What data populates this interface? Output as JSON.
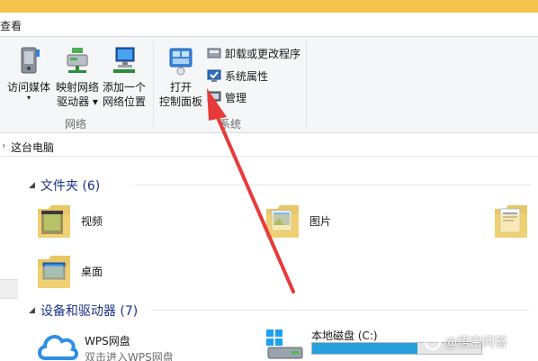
{
  "tabs": {
    "view": "查看"
  },
  "ribbon": {
    "network_group": {
      "label": "网络",
      "buttons": [
        {
          "id": "media",
          "label": "访问媒体"
        },
        {
          "id": "map_drive",
          "label_line1": "映射网络",
          "label_line2": "驱动器"
        },
        {
          "id": "add_location",
          "label_line1": "添加一个",
          "label_line2": "网络位置"
        }
      ]
    },
    "system_group": {
      "label": "系统",
      "open_control_panel": {
        "label_line1": "打开",
        "label_line2": "控制面板"
      },
      "small_buttons": [
        {
          "id": "uninstall",
          "label": "卸载或更改程序"
        },
        {
          "id": "properties",
          "label": "系统属性"
        },
        {
          "id": "manage",
          "label": "管理"
        }
      ]
    }
  },
  "breadcrumb": {
    "current": "这台电脑"
  },
  "folders_section": {
    "title": "文件夹 (6)",
    "items": [
      {
        "name": "视频"
      },
      {
        "name": "图片"
      },
      {
        "name": "桌面"
      }
    ]
  },
  "devices_section": {
    "title": "设备和驱动器 (7)",
    "items": [
      {
        "name": "WPS网盘",
        "subtitle": "双击进入WPS网盘"
      },
      {
        "name": "本地磁盘 (C:)",
        "used_fraction": 0.62
      }
    ]
  },
  "watermark": {
    "text": "@悟空问答"
  },
  "colors": {
    "accent": "#26a0da",
    "section_title": "#1e3287",
    "arrow": "#e83a3a",
    "titlebar": "#f4c54a"
  }
}
